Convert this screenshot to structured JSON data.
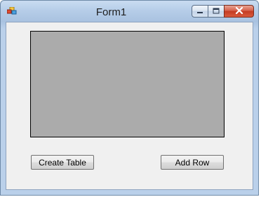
{
  "window": {
    "title": "Form1",
    "icons": {
      "app": "app-icon",
      "minimize": "minimize-icon",
      "maximize": "maximize-icon",
      "close": "close-icon"
    }
  },
  "buttons": {
    "create_table": "Create Table",
    "add_row": "Add Row"
  },
  "colors": {
    "panel_background": "#ababab",
    "form_background": "#f0f0f0",
    "close_button": "#c43b22"
  }
}
